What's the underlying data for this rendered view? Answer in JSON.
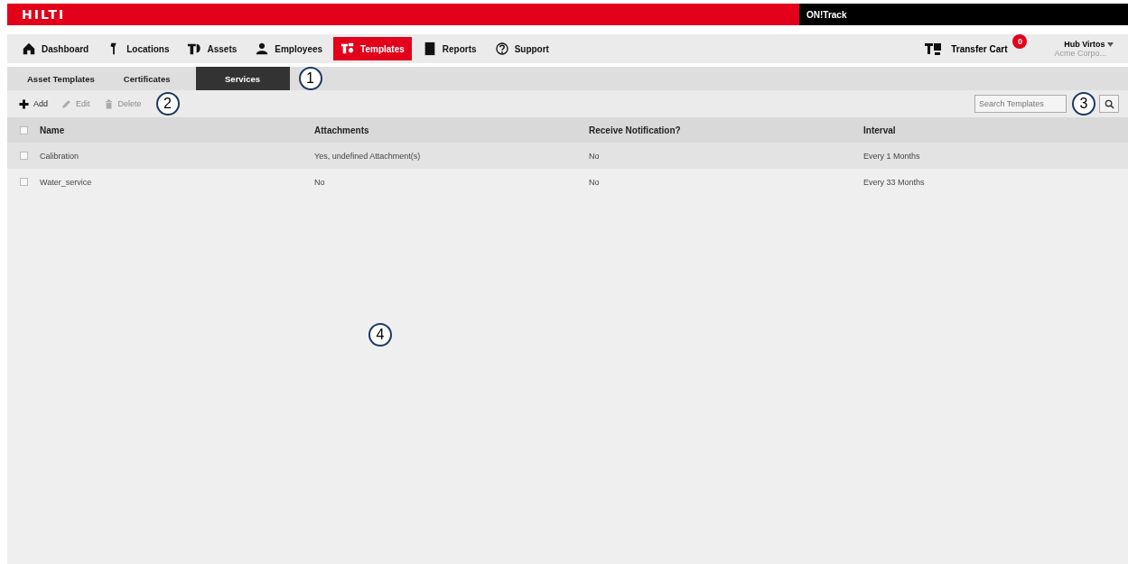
{
  "header": {
    "logo": "HILTI",
    "app_name": "ON!Track"
  },
  "nav": [
    {
      "label": "Dashboard",
      "selected": false
    },
    {
      "label": "Locations",
      "selected": false
    },
    {
      "label": "Assets",
      "selected": false
    },
    {
      "label": "Employees",
      "selected": false
    },
    {
      "label": "Templates",
      "selected": true
    },
    {
      "label": "Reports",
      "selected": false
    },
    {
      "label": "Support",
      "selected": false
    }
  ],
  "transfer_cart": {
    "label": "Transfer Cart",
    "count": "0"
  },
  "user": {
    "name": "Hub Virtos",
    "company": "Acme Corpo..."
  },
  "subtabs": [
    {
      "label": "Asset Templates",
      "selected": false
    },
    {
      "label": "Certificates",
      "selected": false
    },
    {
      "label": "Services",
      "selected": true
    }
  ],
  "toolbar": [
    {
      "label": "Add",
      "disabled": false
    },
    {
      "label": "Edit",
      "disabled": true
    },
    {
      "label": "Delete",
      "disabled": true
    }
  ],
  "search": {
    "placeholder": "Search Templates"
  },
  "table": {
    "select_all_checked": false,
    "columns": [
      "Name",
      "Attachments",
      "Receive Notification?",
      "Interval"
    ],
    "rows": [
      {
        "checked": false,
        "cells": [
          "Calibration",
          "Yes, undefined Attachment(s)",
          "No",
          "Every 1 Months"
        ]
      },
      {
        "checked": false,
        "cells": [
          "Water_service",
          "No",
          "No",
          "Every 33 Months"
        ]
      }
    ]
  },
  "callouts": [
    "1",
    "2",
    "3",
    "4"
  ]
}
